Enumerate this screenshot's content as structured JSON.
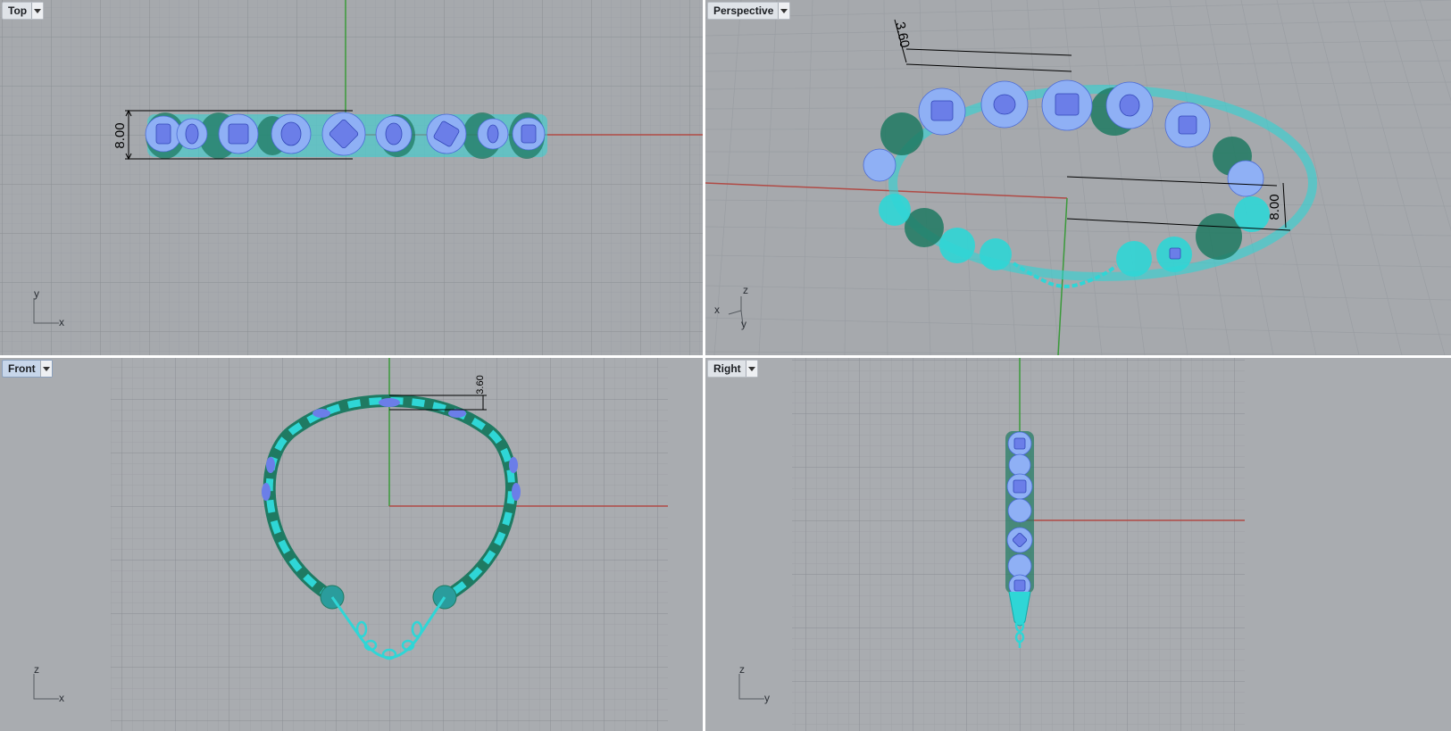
{
  "viewports": {
    "top": {
      "title": "Top",
      "axis_v": "y",
      "axis_h": "x",
      "dimension": "8.00",
      "active": false
    },
    "perspective": {
      "title": "Perspective",
      "axis_z": "z",
      "axis_x": "x",
      "axis_y": "y",
      "dimension_small": "3.60",
      "dimension_large": "8.00",
      "active": false
    },
    "front": {
      "title": "Front",
      "axis_v": "z",
      "axis_h": "x",
      "dimension": "3.60",
      "active": true
    },
    "right": {
      "title": "Right",
      "axis_v": "z",
      "axis_h": "y",
      "active": false
    }
  },
  "icons": {
    "dropdown": "dropdown-arrow-icon",
    "axis": "axis-indicator-icon"
  },
  "colors": {
    "background": "#a6a9ad",
    "grid_minor": "#9a9ea3",
    "grid_major": "#8a8e94",
    "x_axis": "#b04a45",
    "y_axis": "#3a9a3a",
    "metal_cyan": "#2fd6d6",
    "metal_green": "#1f7a62",
    "gem_blue": "#6b7ee8",
    "prong_blue": "#8fb0f5",
    "dimension": "#000000"
  }
}
